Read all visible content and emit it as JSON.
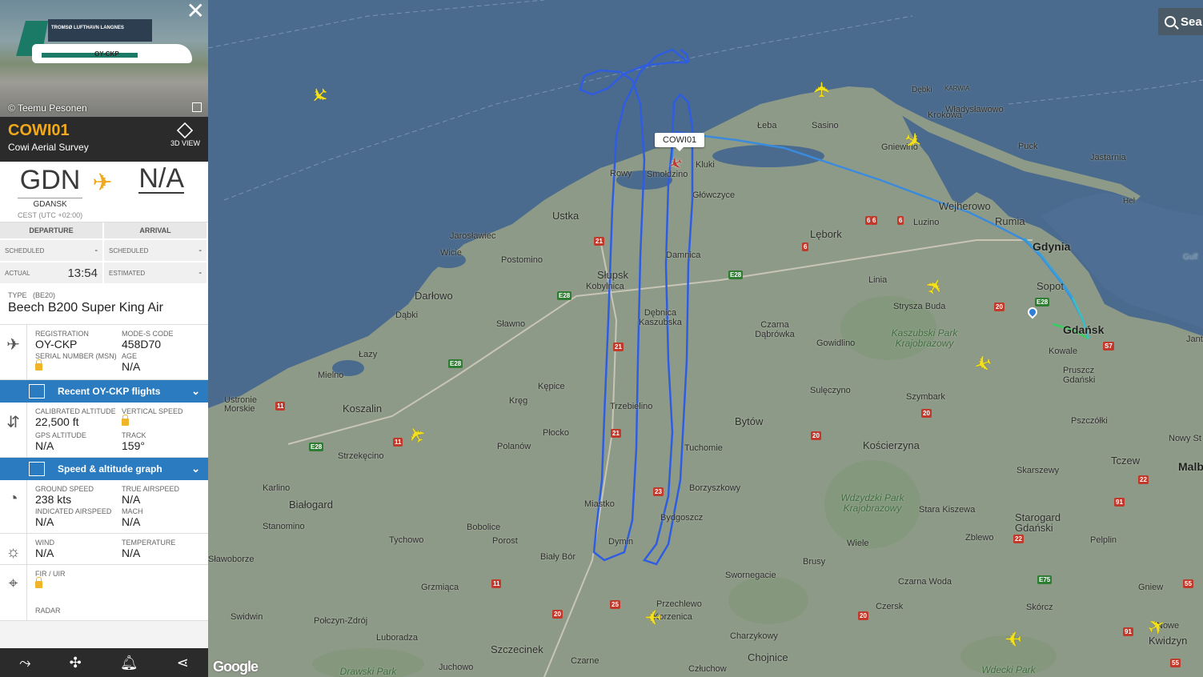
{
  "panel": {
    "photo_credit": "© Teemu Pesonen",
    "photo_hangar_text": "TROMSØ LUFTHAVN LANGNES",
    "photo_reg": "OY-CKP",
    "callsign": "COWI01",
    "operator": "Cowi Aerial Survey",
    "view3d_label": "3D VIEW",
    "origin": {
      "code": "GDN",
      "city": "GDANSK",
      "tz": "CEST (UTC +02:00)"
    },
    "destination": {
      "code": "N/A"
    },
    "departure_header": "DEPARTURE",
    "arrival_header": "ARRIVAL",
    "dep_scheduled_label": "SCHEDULED",
    "dep_scheduled_value": "-",
    "arr_scheduled_label": "SCHEDULED",
    "arr_scheduled_value": "-",
    "dep_actual_label": "ACTUAL",
    "dep_actual_value": "13:54",
    "arr_estimated_label": "ESTIMATED",
    "arr_estimated_value": "-",
    "type_label": "TYPE",
    "type_code": "(BE20)",
    "type_name": "Beech B200 Super King Air",
    "registration_label": "REGISTRATION",
    "registration": "OY-CKP",
    "modes_label": "MODE-S CODE",
    "modes": "458D70",
    "msn_label": "SERIAL NUMBER (MSN)",
    "age_label": "AGE",
    "age": "N/A",
    "recent_flights_label": "Recent OY-CKP flights",
    "cal_alt_label": "CALIBRATED ALTITUDE",
    "cal_alt": "22,500 ft",
    "vs_label": "VERTICAL SPEED",
    "gps_alt_label": "GPS ALTITUDE",
    "gps_alt": "N/A",
    "track_label": "TRACK",
    "track": "159°",
    "graph_label": "Speed & altitude graph",
    "gs_label": "GROUND SPEED",
    "gs": "238 kts",
    "tas_label": "TRUE AIRSPEED",
    "tas": "N/A",
    "ias_label": "INDICATED AIRSPEED",
    "ias": "N/A",
    "mach_label": "MACH",
    "mach": "N/A",
    "wind_label": "WIND",
    "wind": "N/A",
    "temp_label": "TEMPERATURE",
    "temp": "N/A",
    "fir_label": "FIR / UIR",
    "radar_label": "RADAR"
  },
  "map": {
    "search_label": "Sea",
    "callsign_tag": "COWI01",
    "google": "Google",
    "places": [
      "Łeba",
      "Sasino",
      "Dębki",
      "KARWIA",
      "Władysławowo",
      "Krokowa",
      "Puck",
      "Jastarnia",
      "Hel",
      "Gniewino",
      "Rowy",
      "Smołdzino",
      "Kluki",
      "Główczyce",
      "Ustka",
      "Wejherowo",
      "Rumia",
      "Luzino",
      "Gdynia",
      "Lębork",
      "Jarosławiec",
      "Wicie",
      "Postomino",
      "Słupsk",
      "Kobylnica",
      "Damnica",
      "Sopot",
      "Linia",
      "Strysza Buda",
      "Darłowo",
      "Dąbki",
      "Gdańsk",
      "Kowale",
      "Sławno",
      "Dębnica Kaszubska",
      "Czarna Dąbrówka",
      "Gowidlino",
      "Łazy",
      "Pruszcz Gdański",
      "Mielno",
      "Kępice",
      "Sulęczyno",
      "Szymbark",
      "Ustronie Morskie",
      "Koszalin",
      "Kręg",
      "Trzebielino",
      "Bytów",
      "Kościerzyna",
      "Pszczółki",
      "Polanów",
      "Płocko",
      "Tuchomie",
      "Nowy St",
      "Strzekęcino",
      "Skarszewy",
      "Tczew",
      "Malb",
      "Karlino",
      "Borzyszkowy",
      "Białogard",
      "Miastko",
      "Stara Kiszewa",
      "Starogard Gdański",
      "Stanomino",
      "Bobolice",
      "Bydgoszcz",
      "Porost",
      "Zblewo",
      "Pelplin",
      "Tychowo",
      "Dymin",
      "Wiele",
      "Sławoborze",
      "Biały Bór",
      "Brusy",
      "Swornegacie",
      "Czarna Woda",
      "Grzmiąca",
      "Gniew",
      "Przechlewo",
      "Czersk",
      "Skórcz",
      "Swidwin",
      "Połczyn-Zdrój",
      "Korzenica",
      "Luboradza",
      "Charzykowy",
      "Szczecinek",
      "Chojnice",
      "Kwidzyn",
      "Czarne",
      "Człuchow",
      "Juchowo",
      "Jant",
      "Gulf",
      "Nowe",
      "Kaszubski Park Krajobrazowy",
      "Wdzydzki Park Krajobrazowy",
      "Drawski Park",
      "Wdecki Park"
    ],
    "roads": [
      "21",
      "21",
      "21",
      "21",
      "23",
      "E28",
      "E28",
      "E28",
      "E28",
      "E28",
      "6",
      "6",
      "6",
      "11",
      "11",
      "11",
      "20",
      "20",
      "20",
      "20",
      "20",
      "20",
      "22",
      "22",
      "22",
      "91",
      "91",
      "55",
      "55",
      "25",
      "E75",
      "S7"
    ]
  }
}
